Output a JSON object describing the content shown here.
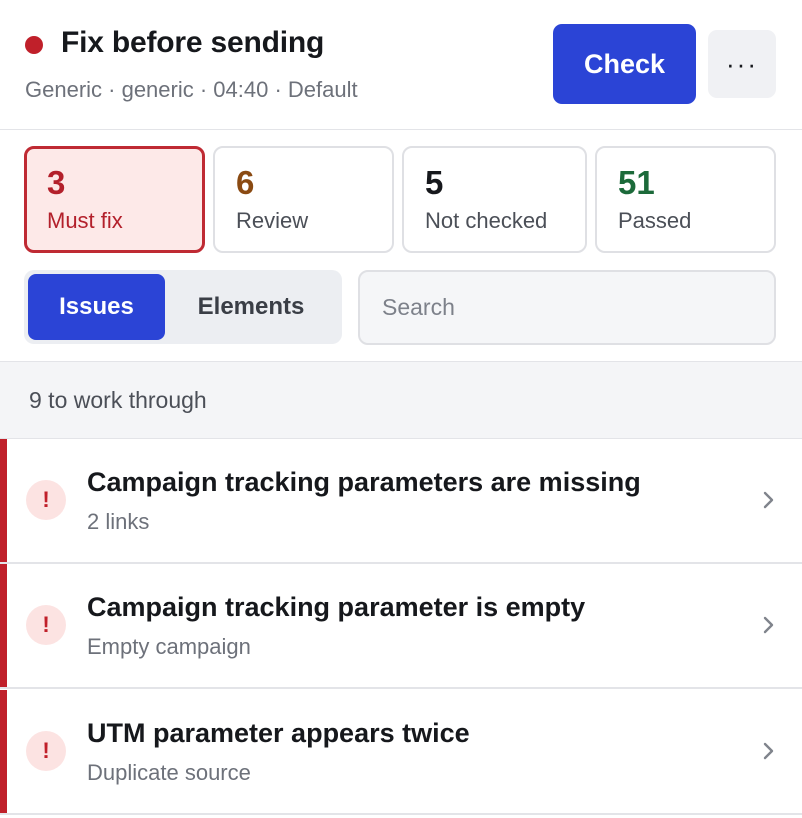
{
  "header": {
    "status_color": "#c0202a",
    "title": "Fix before sending",
    "subtitle": "Generic · generic · 04:40 · Default",
    "check_label": "Check",
    "more_label": "···"
  },
  "stats": {
    "must_fix": {
      "value": "3",
      "label": "Must fix"
    },
    "review": {
      "value": "6",
      "label": "Review"
    },
    "not_checked": {
      "value": "5",
      "label": "Not checked"
    },
    "passed": {
      "value": "51",
      "label": "Passed"
    }
  },
  "tabs": {
    "issues": "Issues",
    "elements": "Elements",
    "selected": "Issues"
  },
  "search": {
    "placeholder": "Search",
    "value": ""
  },
  "section": {
    "label": "9 to work through"
  },
  "issues": [
    {
      "title": "Campaign tracking parameters are missing",
      "subtitle": "2 links",
      "icon": "alert-icon"
    },
    {
      "title": "Campaign tracking parameter is empty",
      "subtitle": "Empty campaign",
      "icon": "alert-icon"
    },
    {
      "title": "UTM parameter appears twice",
      "subtitle": "Duplicate source",
      "icon": "alert-icon"
    }
  ],
  "colors": {
    "accent": "#2b44d6",
    "danger": "#c0202a",
    "review": "#8a4a12",
    "passed": "#1c6a3a"
  }
}
